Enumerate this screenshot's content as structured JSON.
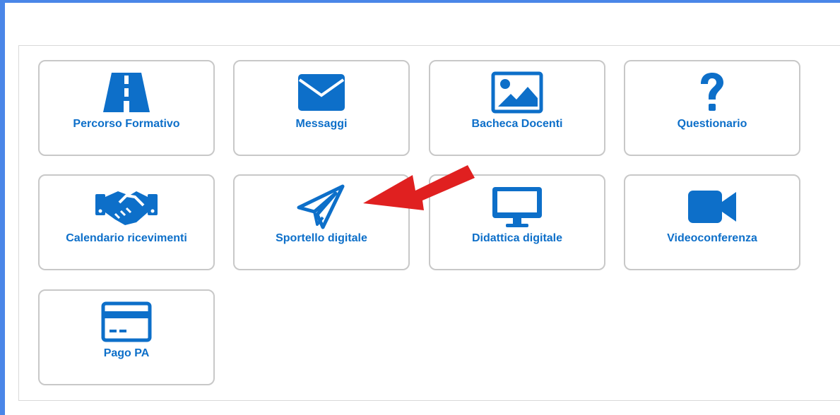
{
  "tiles": [
    {
      "label": "Percorso Formativo",
      "icon": "road-icon"
    },
    {
      "label": "Messaggi",
      "icon": "envelope-icon"
    },
    {
      "label": "Bacheca Docenti",
      "icon": "image-icon"
    },
    {
      "label": "Questionario",
      "icon": "question-icon"
    },
    {
      "label": "Calendario ricevimenti",
      "icon": "handshake-icon"
    },
    {
      "label": "Sportello digitale",
      "icon": "paper-plane-icon"
    },
    {
      "label": "Didattica digitale",
      "icon": "monitor-icon"
    },
    {
      "label": "Videoconferenza",
      "icon": "video-camera-icon"
    },
    {
      "label": "Pago PA",
      "icon": "credit-card-icon"
    }
  ],
  "colors": {
    "accent": "#0d6fc9",
    "frame": "#4a86e8",
    "annotation_arrow": "#e02020"
  }
}
